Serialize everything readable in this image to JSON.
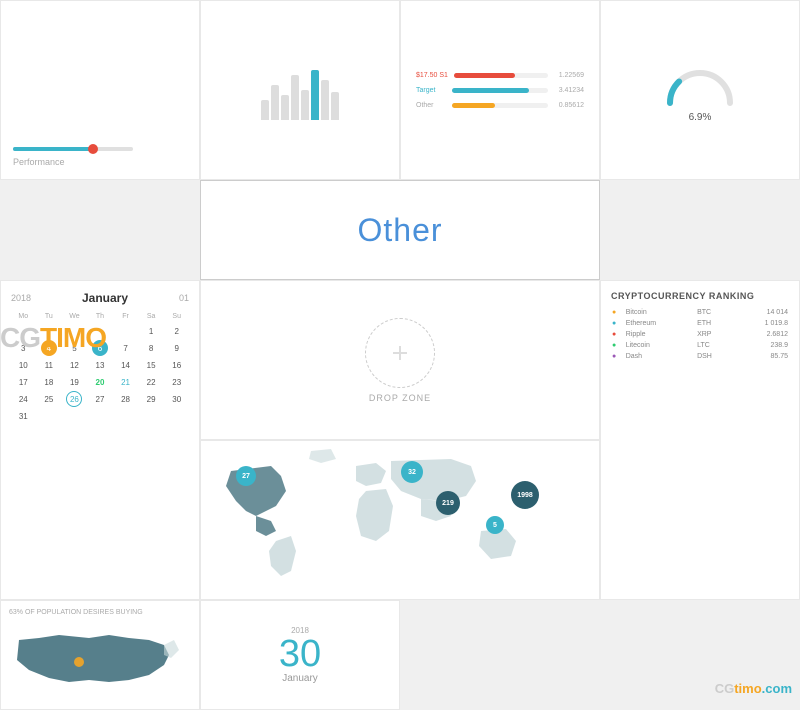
{
  "watermark": {
    "cg": "CG",
    "timo": "TIMO",
    "bottom_cg": "CG",
    "bottom_timo": "timo",
    "bottom_com": ".com"
  },
  "other_label": "Other",
  "row1": {
    "perf_label": "Performance",
    "gauge_pct": "6.9%",
    "progress": {
      "label1": "$17.50 S1",
      "val1": "1.22569",
      "label2": "",
      "val2": ""
    }
  },
  "calendar": {
    "year": "2018",
    "month": "January",
    "day_num": "01",
    "days": [
      "Mo",
      "Tu",
      "We",
      "Th",
      "Fr",
      "Sa",
      "Su"
    ],
    "weeks": [
      [
        " ",
        " ",
        " ",
        " ",
        " ",
        "1",
        "2"
      ],
      [
        "3",
        "4",
        "5",
        "6",
        "7",
        "8",
        "9"
      ],
      [
        "10",
        "11",
        "12",
        "13",
        "14",
        "15",
        "16"
      ],
      [
        "17",
        "18",
        "19",
        "20",
        "21",
        "22",
        "23"
      ],
      [
        "24",
        "25",
        "26",
        "27",
        "28",
        "29",
        "30"
      ],
      [
        "31",
        " ",
        " ",
        " ",
        " ",
        " ",
        " "
      ]
    ]
  },
  "drop_zone": {
    "label": "DROP ZONE"
  },
  "crypto": {
    "title": "CRYPTOCURRENCY RANKING",
    "items": [
      {
        "name": "Bitcoin",
        "symbol": "BTC",
        "val": "14 014",
        "color": "orange"
      },
      {
        "name": "Ethereum",
        "symbol": "ETH",
        "val": "1 019.8",
        "color": "teal"
      },
      {
        "name": "Ripple",
        "symbol": "XRP",
        "val": "2.6812",
        "color": "red"
      },
      {
        "name": "Litecoin",
        "symbol": "LTC",
        "val": "238.9",
        "color": "green"
      },
      {
        "name": "Dash",
        "symbol": "DSH",
        "val": "85.75",
        "color": "purple"
      }
    ]
  },
  "date_card": {
    "year": "2018",
    "day": "30",
    "month": "January"
  },
  "usa_card": {
    "title": "63% OF POPULATION DESIRES BUYING"
  },
  "map_pins": [
    {
      "id": "pin1",
      "val": "27",
      "color": "#3ab4c9"
    },
    {
      "id": "pin2",
      "val": "32",
      "color": "#3ab4c9"
    },
    {
      "id": "pin3",
      "val": "5",
      "color": "#3ab4c9"
    },
    {
      "id": "pin4",
      "val": "219",
      "color": "#2c5f6e"
    },
    {
      "id": "pin5",
      "val": "1998",
      "color": "#2c5f6e"
    }
  ]
}
